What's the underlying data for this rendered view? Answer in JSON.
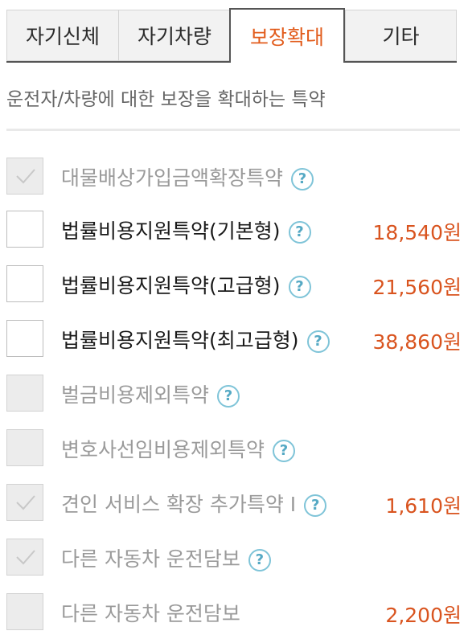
{
  "tabs": [
    {
      "label": "자기신체"
    },
    {
      "label": "자기차량"
    },
    {
      "label": "보장확대",
      "active": true
    },
    {
      "label": "기타"
    }
  ],
  "description": "운전자/차량에 대한 보장을 확대하는 특약",
  "items": [
    {
      "label": "대물배상가입금액확장특약",
      "price": "",
      "checked": true,
      "disabled": true
    },
    {
      "label": "법률비용지원특약(기본형)",
      "price": "18,540원",
      "checked": false,
      "disabled": false
    },
    {
      "label": "법률비용지원특약(고급형)",
      "price": "21,560원",
      "checked": false,
      "disabled": false
    },
    {
      "label": "법률비용지원특약(최고급형)",
      "price": "38,860원",
      "checked": false,
      "disabled": false
    },
    {
      "label": "벌금비용제외특약",
      "price": "",
      "checked": false,
      "disabled": true
    },
    {
      "label": "변호사선임비용제외특약",
      "price": "",
      "checked": false,
      "disabled": true
    },
    {
      "label": "견인 서비스 확장 추가특약 I",
      "price": "1,610원",
      "checked": true,
      "disabled": true
    },
    {
      "label": "다른 자동차 운전담보",
      "price": "",
      "checked": true,
      "disabled": true
    },
    {
      "label": "다른 자동차 운전담보",
      "price": "2,200원",
      "checked": false,
      "disabled": true
    }
  ],
  "help_icon": "question-circle-icon",
  "help_glyph": "?",
  "colors": {
    "accent": "#e25c1c",
    "price": "#d9541f",
    "help": "#55a9c4"
  }
}
